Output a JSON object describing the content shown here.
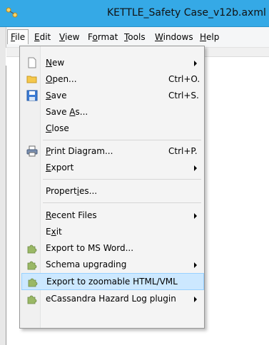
{
  "window": {
    "title": "KETTLE_Safety Case_v12b.axml"
  },
  "menubar": {
    "items": [
      {
        "label": "File",
        "accel": "F",
        "rest": "ile"
      },
      {
        "label": "Edit",
        "accel": "E",
        "rest": "dit"
      },
      {
        "label": "View",
        "accel": "V",
        "rest": "iew"
      },
      {
        "label": "Format",
        "pre": "F",
        "accel": "o",
        "rest": "rmat"
      },
      {
        "label": "Tools",
        "accel": "T",
        "rest": "ools"
      },
      {
        "label": "Windows",
        "accel": "W",
        "rest": "indows"
      },
      {
        "label": "Help",
        "accel": "H",
        "rest": "elp"
      }
    ]
  },
  "file_menu": {
    "items": [
      {
        "label": "New",
        "pre": "",
        "accel": "N",
        "rest": "ew",
        "shortcut": "",
        "submenu": true,
        "icon": "new-document-icon"
      },
      {
        "label": "Open...",
        "pre": "",
        "accel": "O",
        "rest": "pen...",
        "shortcut": "Ctrl+O.",
        "submenu": false,
        "icon": "open-folder-icon"
      },
      {
        "label": "Save",
        "pre": "",
        "accel": "S",
        "rest": "ave",
        "shortcut": "Ctrl+S.",
        "submenu": false,
        "icon": "save-floppy-icon"
      },
      {
        "label": "Save As...",
        "pre": "Save ",
        "accel": "A",
        "rest": "s...",
        "shortcut": "",
        "submenu": false,
        "icon": ""
      },
      {
        "label": "Close",
        "pre": "",
        "accel": "C",
        "rest": "lose",
        "shortcut": "",
        "submenu": false,
        "icon": ""
      },
      {
        "label": "Print Diagram...",
        "pre": "",
        "accel": "P",
        "rest": "rint Diagram...",
        "shortcut": "Ctrl+P.",
        "submenu": false,
        "icon": "printer-icon"
      },
      {
        "label": "Export",
        "pre": "",
        "accel": "E",
        "rest": "xport",
        "shortcut": "",
        "submenu": true,
        "icon": ""
      },
      {
        "label": "Properties...",
        "pre": "Propert",
        "accel": "i",
        "rest": "es...",
        "shortcut": "",
        "submenu": false,
        "icon": ""
      },
      {
        "label": "Recent Files",
        "pre": "",
        "accel": "R",
        "rest": "ecent Files",
        "shortcut": "",
        "submenu": true,
        "icon": ""
      },
      {
        "label": "Exit",
        "pre": "E",
        "accel": "x",
        "rest": "it",
        "shortcut": "",
        "submenu": false,
        "icon": ""
      },
      {
        "label": "Export to MS Word...",
        "pre": "",
        "accel": "",
        "rest": "Export to MS Word...",
        "shortcut": "",
        "submenu": false,
        "icon": "plugin-puzzle-icon"
      },
      {
        "label": "Schema upgrading",
        "pre": "",
        "accel": "",
        "rest": "Schema upgrading",
        "shortcut": "",
        "submenu": true,
        "icon": "plugin-puzzle-icon"
      },
      {
        "label": "Export to zoomable HTML/VML",
        "pre": "",
        "accel": "",
        "rest": "Export to zoomable HTML/VML",
        "shortcut": "",
        "submenu": false,
        "icon": "plugin-puzzle-icon",
        "highlighted": true
      },
      {
        "label": "eCassandra Hazard Log plugin",
        "pre": "",
        "accel": "",
        "rest": "eCassandra Hazard Log plugin",
        "shortcut": "",
        "submenu": true,
        "icon": "plugin-puzzle-icon"
      }
    ]
  },
  "colors": {
    "titlebar": "#35a9e6",
    "highlight": "#cce8ff",
    "highlight_border": "#99d1ff"
  }
}
